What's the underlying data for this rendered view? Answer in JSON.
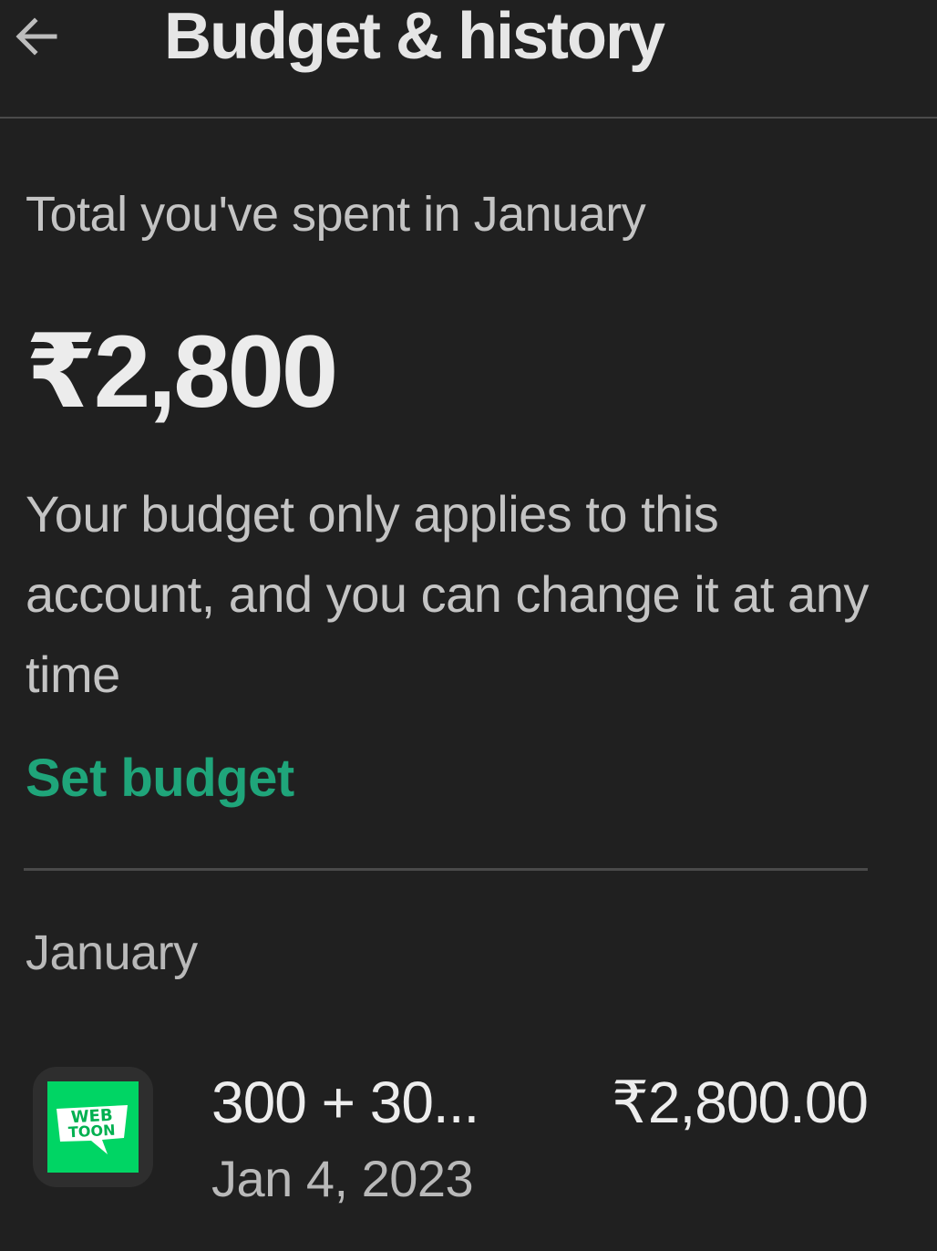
{
  "header": {
    "back_icon": "arrow-left-icon",
    "title": "Budget & history"
  },
  "summary": {
    "label": "Total you've spent in January",
    "amount": "₹2,800",
    "note": "Your budget only applies to this account, and you can change it at any time",
    "set_budget_label": "Set budget"
  },
  "history": {
    "month_label": "January",
    "transactions": [
      {
        "icon": "webtoon-app-icon",
        "icon_text_line1": "WEB",
        "icon_text_line2": "TOON",
        "title": "300 + 30...",
        "date": "Jan 4, 2023",
        "amount": "₹2,800.00"
      }
    ]
  },
  "colors": {
    "background": "#202020",
    "accent": "#1fa57a",
    "webtoon_green": "#00d564"
  }
}
